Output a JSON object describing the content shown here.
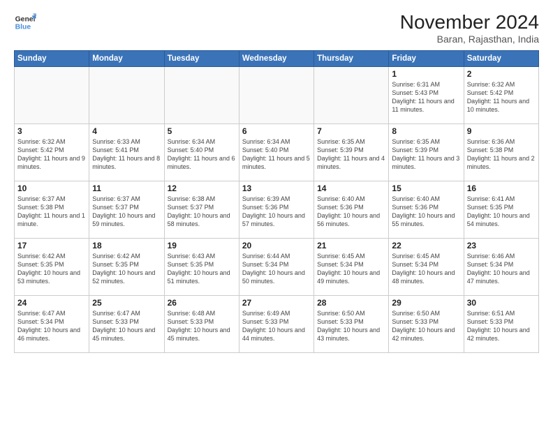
{
  "header": {
    "logo_line1": "General",
    "logo_line2": "Blue",
    "month_title": "November 2024",
    "location": "Baran, Rajasthan, India"
  },
  "weekdays": [
    "Sunday",
    "Monday",
    "Tuesday",
    "Wednesday",
    "Thursday",
    "Friday",
    "Saturday"
  ],
  "weeks": [
    [
      {
        "day": "",
        "text": ""
      },
      {
        "day": "",
        "text": ""
      },
      {
        "day": "",
        "text": ""
      },
      {
        "day": "",
        "text": ""
      },
      {
        "day": "",
        "text": ""
      },
      {
        "day": "1",
        "text": "Sunrise: 6:31 AM\nSunset: 5:43 PM\nDaylight: 11 hours and 11 minutes."
      },
      {
        "day": "2",
        "text": "Sunrise: 6:32 AM\nSunset: 5:42 PM\nDaylight: 11 hours and 10 minutes."
      }
    ],
    [
      {
        "day": "3",
        "text": "Sunrise: 6:32 AM\nSunset: 5:42 PM\nDaylight: 11 hours and 9 minutes."
      },
      {
        "day": "4",
        "text": "Sunrise: 6:33 AM\nSunset: 5:41 PM\nDaylight: 11 hours and 8 minutes."
      },
      {
        "day": "5",
        "text": "Sunrise: 6:34 AM\nSunset: 5:40 PM\nDaylight: 11 hours and 6 minutes."
      },
      {
        "day": "6",
        "text": "Sunrise: 6:34 AM\nSunset: 5:40 PM\nDaylight: 11 hours and 5 minutes."
      },
      {
        "day": "7",
        "text": "Sunrise: 6:35 AM\nSunset: 5:39 PM\nDaylight: 11 hours and 4 minutes."
      },
      {
        "day": "8",
        "text": "Sunrise: 6:35 AM\nSunset: 5:39 PM\nDaylight: 11 hours and 3 minutes."
      },
      {
        "day": "9",
        "text": "Sunrise: 6:36 AM\nSunset: 5:38 PM\nDaylight: 11 hours and 2 minutes."
      }
    ],
    [
      {
        "day": "10",
        "text": "Sunrise: 6:37 AM\nSunset: 5:38 PM\nDaylight: 11 hours and 1 minute."
      },
      {
        "day": "11",
        "text": "Sunrise: 6:37 AM\nSunset: 5:37 PM\nDaylight: 10 hours and 59 minutes."
      },
      {
        "day": "12",
        "text": "Sunrise: 6:38 AM\nSunset: 5:37 PM\nDaylight: 10 hours and 58 minutes."
      },
      {
        "day": "13",
        "text": "Sunrise: 6:39 AM\nSunset: 5:36 PM\nDaylight: 10 hours and 57 minutes."
      },
      {
        "day": "14",
        "text": "Sunrise: 6:40 AM\nSunset: 5:36 PM\nDaylight: 10 hours and 56 minutes."
      },
      {
        "day": "15",
        "text": "Sunrise: 6:40 AM\nSunset: 5:36 PM\nDaylight: 10 hours and 55 minutes."
      },
      {
        "day": "16",
        "text": "Sunrise: 6:41 AM\nSunset: 5:35 PM\nDaylight: 10 hours and 54 minutes."
      }
    ],
    [
      {
        "day": "17",
        "text": "Sunrise: 6:42 AM\nSunset: 5:35 PM\nDaylight: 10 hours and 53 minutes."
      },
      {
        "day": "18",
        "text": "Sunrise: 6:42 AM\nSunset: 5:35 PM\nDaylight: 10 hours and 52 minutes."
      },
      {
        "day": "19",
        "text": "Sunrise: 6:43 AM\nSunset: 5:35 PM\nDaylight: 10 hours and 51 minutes."
      },
      {
        "day": "20",
        "text": "Sunrise: 6:44 AM\nSunset: 5:34 PM\nDaylight: 10 hours and 50 minutes."
      },
      {
        "day": "21",
        "text": "Sunrise: 6:45 AM\nSunset: 5:34 PM\nDaylight: 10 hours and 49 minutes."
      },
      {
        "day": "22",
        "text": "Sunrise: 6:45 AM\nSunset: 5:34 PM\nDaylight: 10 hours and 48 minutes."
      },
      {
        "day": "23",
        "text": "Sunrise: 6:46 AM\nSunset: 5:34 PM\nDaylight: 10 hours and 47 minutes."
      }
    ],
    [
      {
        "day": "24",
        "text": "Sunrise: 6:47 AM\nSunset: 5:34 PM\nDaylight: 10 hours and 46 minutes."
      },
      {
        "day": "25",
        "text": "Sunrise: 6:47 AM\nSunset: 5:33 PM\nDaylight: 10 hours and 45 minutes."
      },
      {
        "day": "26",
        "text": "Sunrise: 6:48 AM\nSunset: 5:33 PM\nDaylight: 10 hours and 45 minutes."
      },
      {
        "day": "27",
        "text": "Sunrise: 6:49 AM\nSunset: 5:33 PM\nDaylight: 10 hours and 44 minutes."
      },
      {
        "day": "28",
        "text": "Sunrise: 6:50 AM\nSunset: 5:33 PM\nDaylight: 10 hours and 43 minutes."
      },
      {
        "day": "29",
        "text": "Sunrise: 6:50 AM\nSunset: 5:33 PM\nDaylight: 10 hours and 42 minutes."
      },
      {
        "day": "30",
        "text": "Sunrise: 6:51 AM\nSunset: 5:33 PM\nDaylight: 10 hours and 42 minutes."
      }
    ]
  ]
}
